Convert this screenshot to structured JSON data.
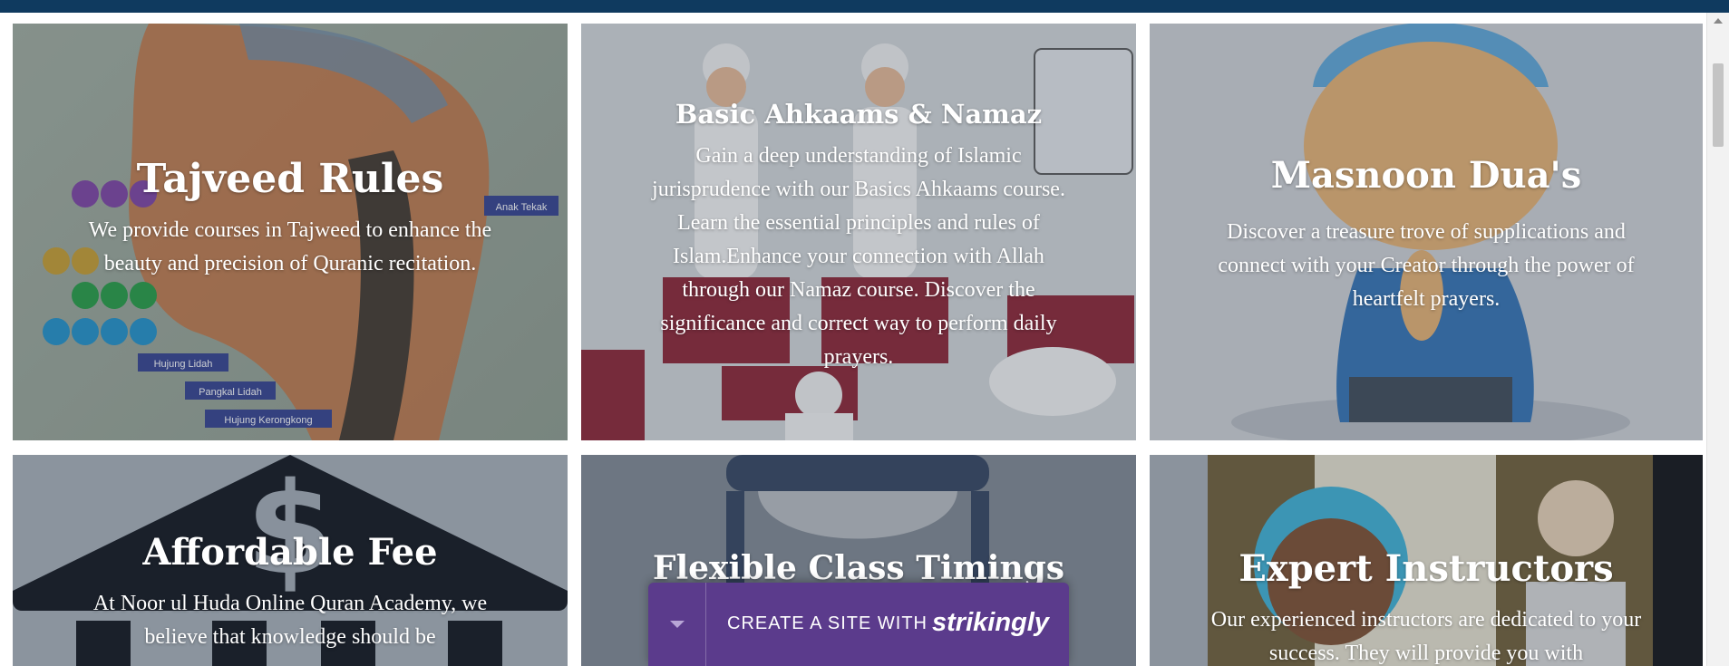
{
  "courses": [
    {
      "title": "Tajveed Rules",
      "description": "We provide courses in Tajweed to enhance the beauty and precision of Quranic recitation.",
      "image_labels": [
        "Anak Tekak",
        "Hujung Lidah",
        "Pangkal Lidah",
        "Hujung Kerongkong"
      ]
    },
    {
      "title": "Basic Ahkaams & Namaz",
      "description": "Gain a deep understanding of Islamic jurisprudence with our Basics Ahkaams course. Learn the essential principles and rules of Islam.Enhance your connection with Allah through our Namaz course. Discover the significance and correct way to perform daily prayers."
    },
    {
      "title": "Masnoon Dua's",
      "description": "Discover a treasure trove of supplications and connect with your Creator through the power of heartfelt prayers."
    },
    {
      "title": "Affordable Fee",
      "description": "At Noor ul Huda Online Quran Academy, we believe that knowledge should be",
      "image_symbol": "$"
    },
    {
      "title": "Flexible Class Timings",
      "description": ""
    },
    {
      "title": "Expert Instructors",
      "description": "Our experienced instructors are dedicated to your success. They will provide you with"
    }
  ],
  "banner": {
    "text": "CREATE A SITE WITH",
    "brand": "strikingly"
  }
}
